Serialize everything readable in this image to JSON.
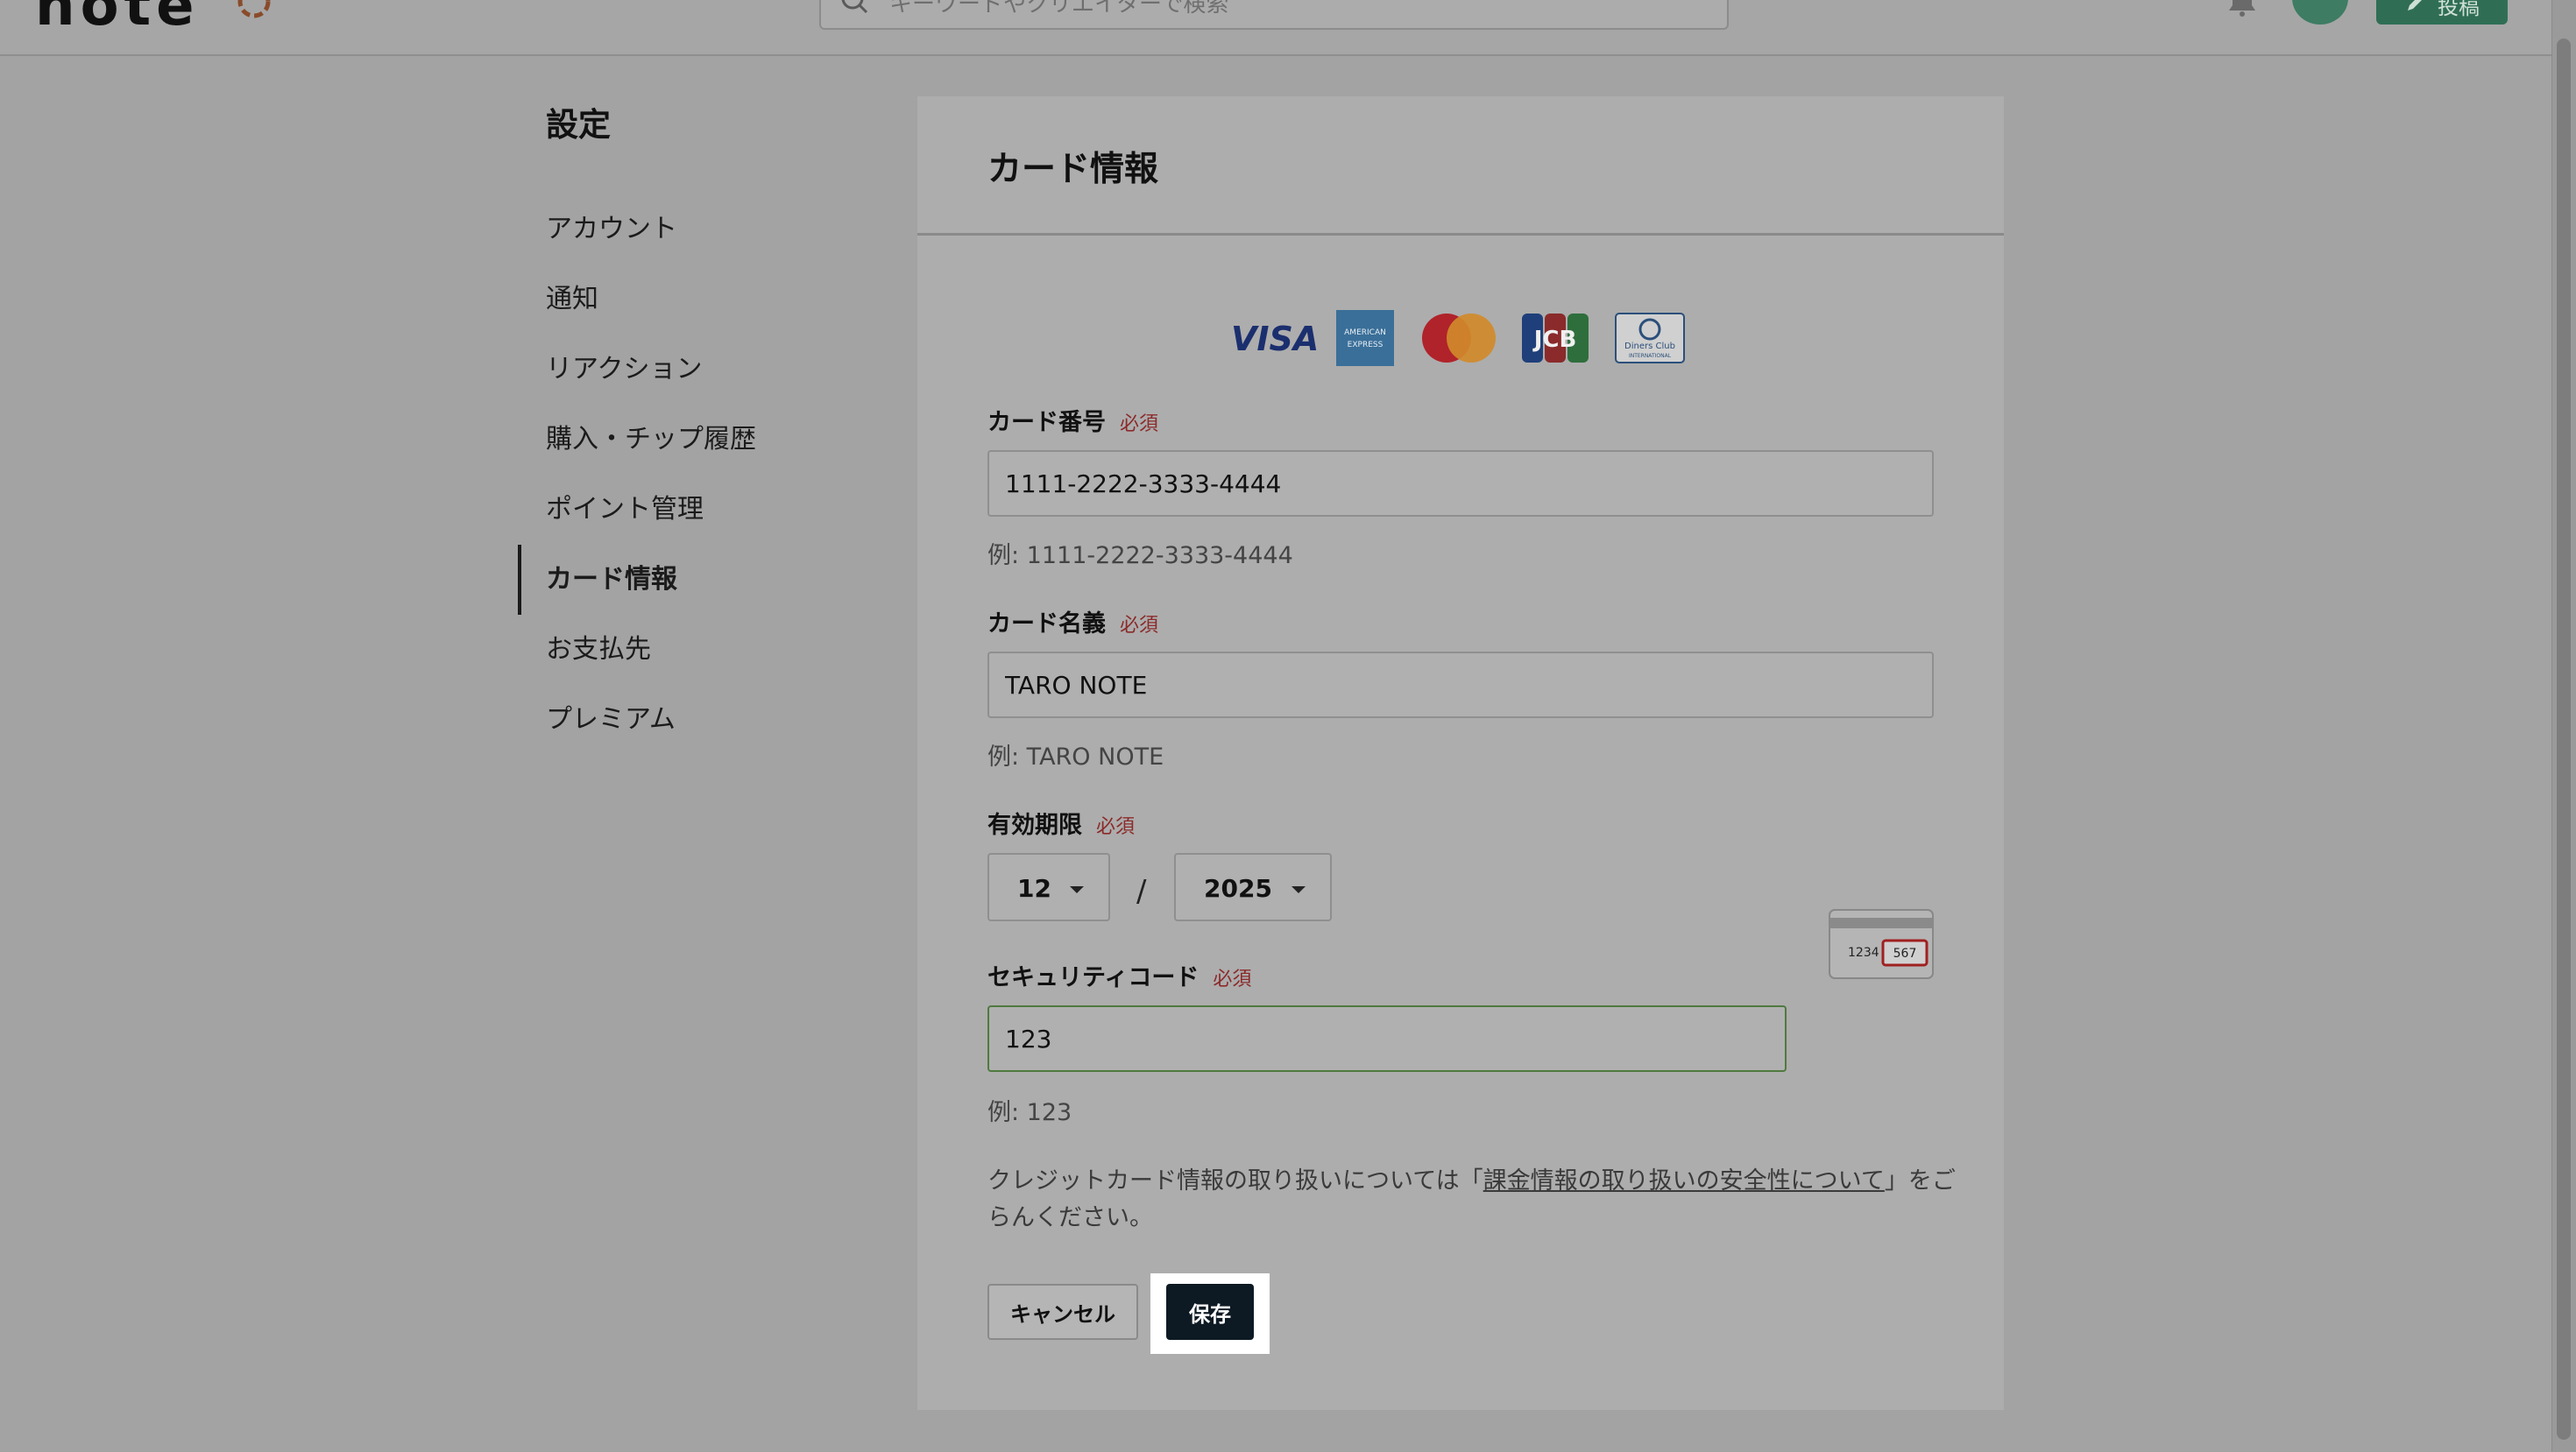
{
  "header": {
    "logo_text": "note",
    "search_placeholder": "キーワードやクリエイターで検索",
    "post_label": "投稿"
  },
  "sidebar": {
    "title": "設定",
    "items": [
      {
        "label": "アカウント"
      },
      {
        "label": "通知"
      },
      {
        "label": "リアクション"
      },
      {
        "label": "購入・チップ履歴"
      },
      {
        "label": "ポイント管理"
      },
      {
        "label": "カード情報",
        "active": true
      },
      {
        "label": "お支払先"
      },
      {
        "label": "プレミアム"
      }
    ]
  },
  "card_form": {
    "title": "カード情報",
    "brands": [
      "VISA",
      "AMERICAN EXPRESS",
      "Mastercard",
      "JCB",
      "Diners Club INTERNATIONAL"
    ],
    "required_label": "必須",
    "card_number": {
      "label": "カード番号",
      "value": "1111-2222-3333-4444",
      "hint": "例: 1111-2222-3333-4444"
    },
    "card_name": {
      "label": "カード名義",
      "value": "TARO NOTE",
      "hint": "例: TARO NOTE"
    },
    "expiry": {
      "label": "有効期限",
      "month": "12",
      "separator": "/",
      "year": "2025"
    },
    "security_code": {
      "label": "セキュリティコード",
      "value": "123",
      "hint": "例: 123",
      "card_sample_numbers": [
        "1234",
        "567"
      ]
    },
    "note_prefix": "クレジットカード情報の取り扱いについては「",
    "note_link": "課金情報の取り扱いの安全性について",
    "note_suffix": "」をごらんください。",
    "cancel_label": "キャンセル",
    "save_label": "保存"
  },
  "colors": {
    "overlay_background": "#a3a3a3",
    "accent_green": "#2f6e55",
    "save_button": "#0d1a24",
    "required_text": "#8b2a2a"
  }
}
